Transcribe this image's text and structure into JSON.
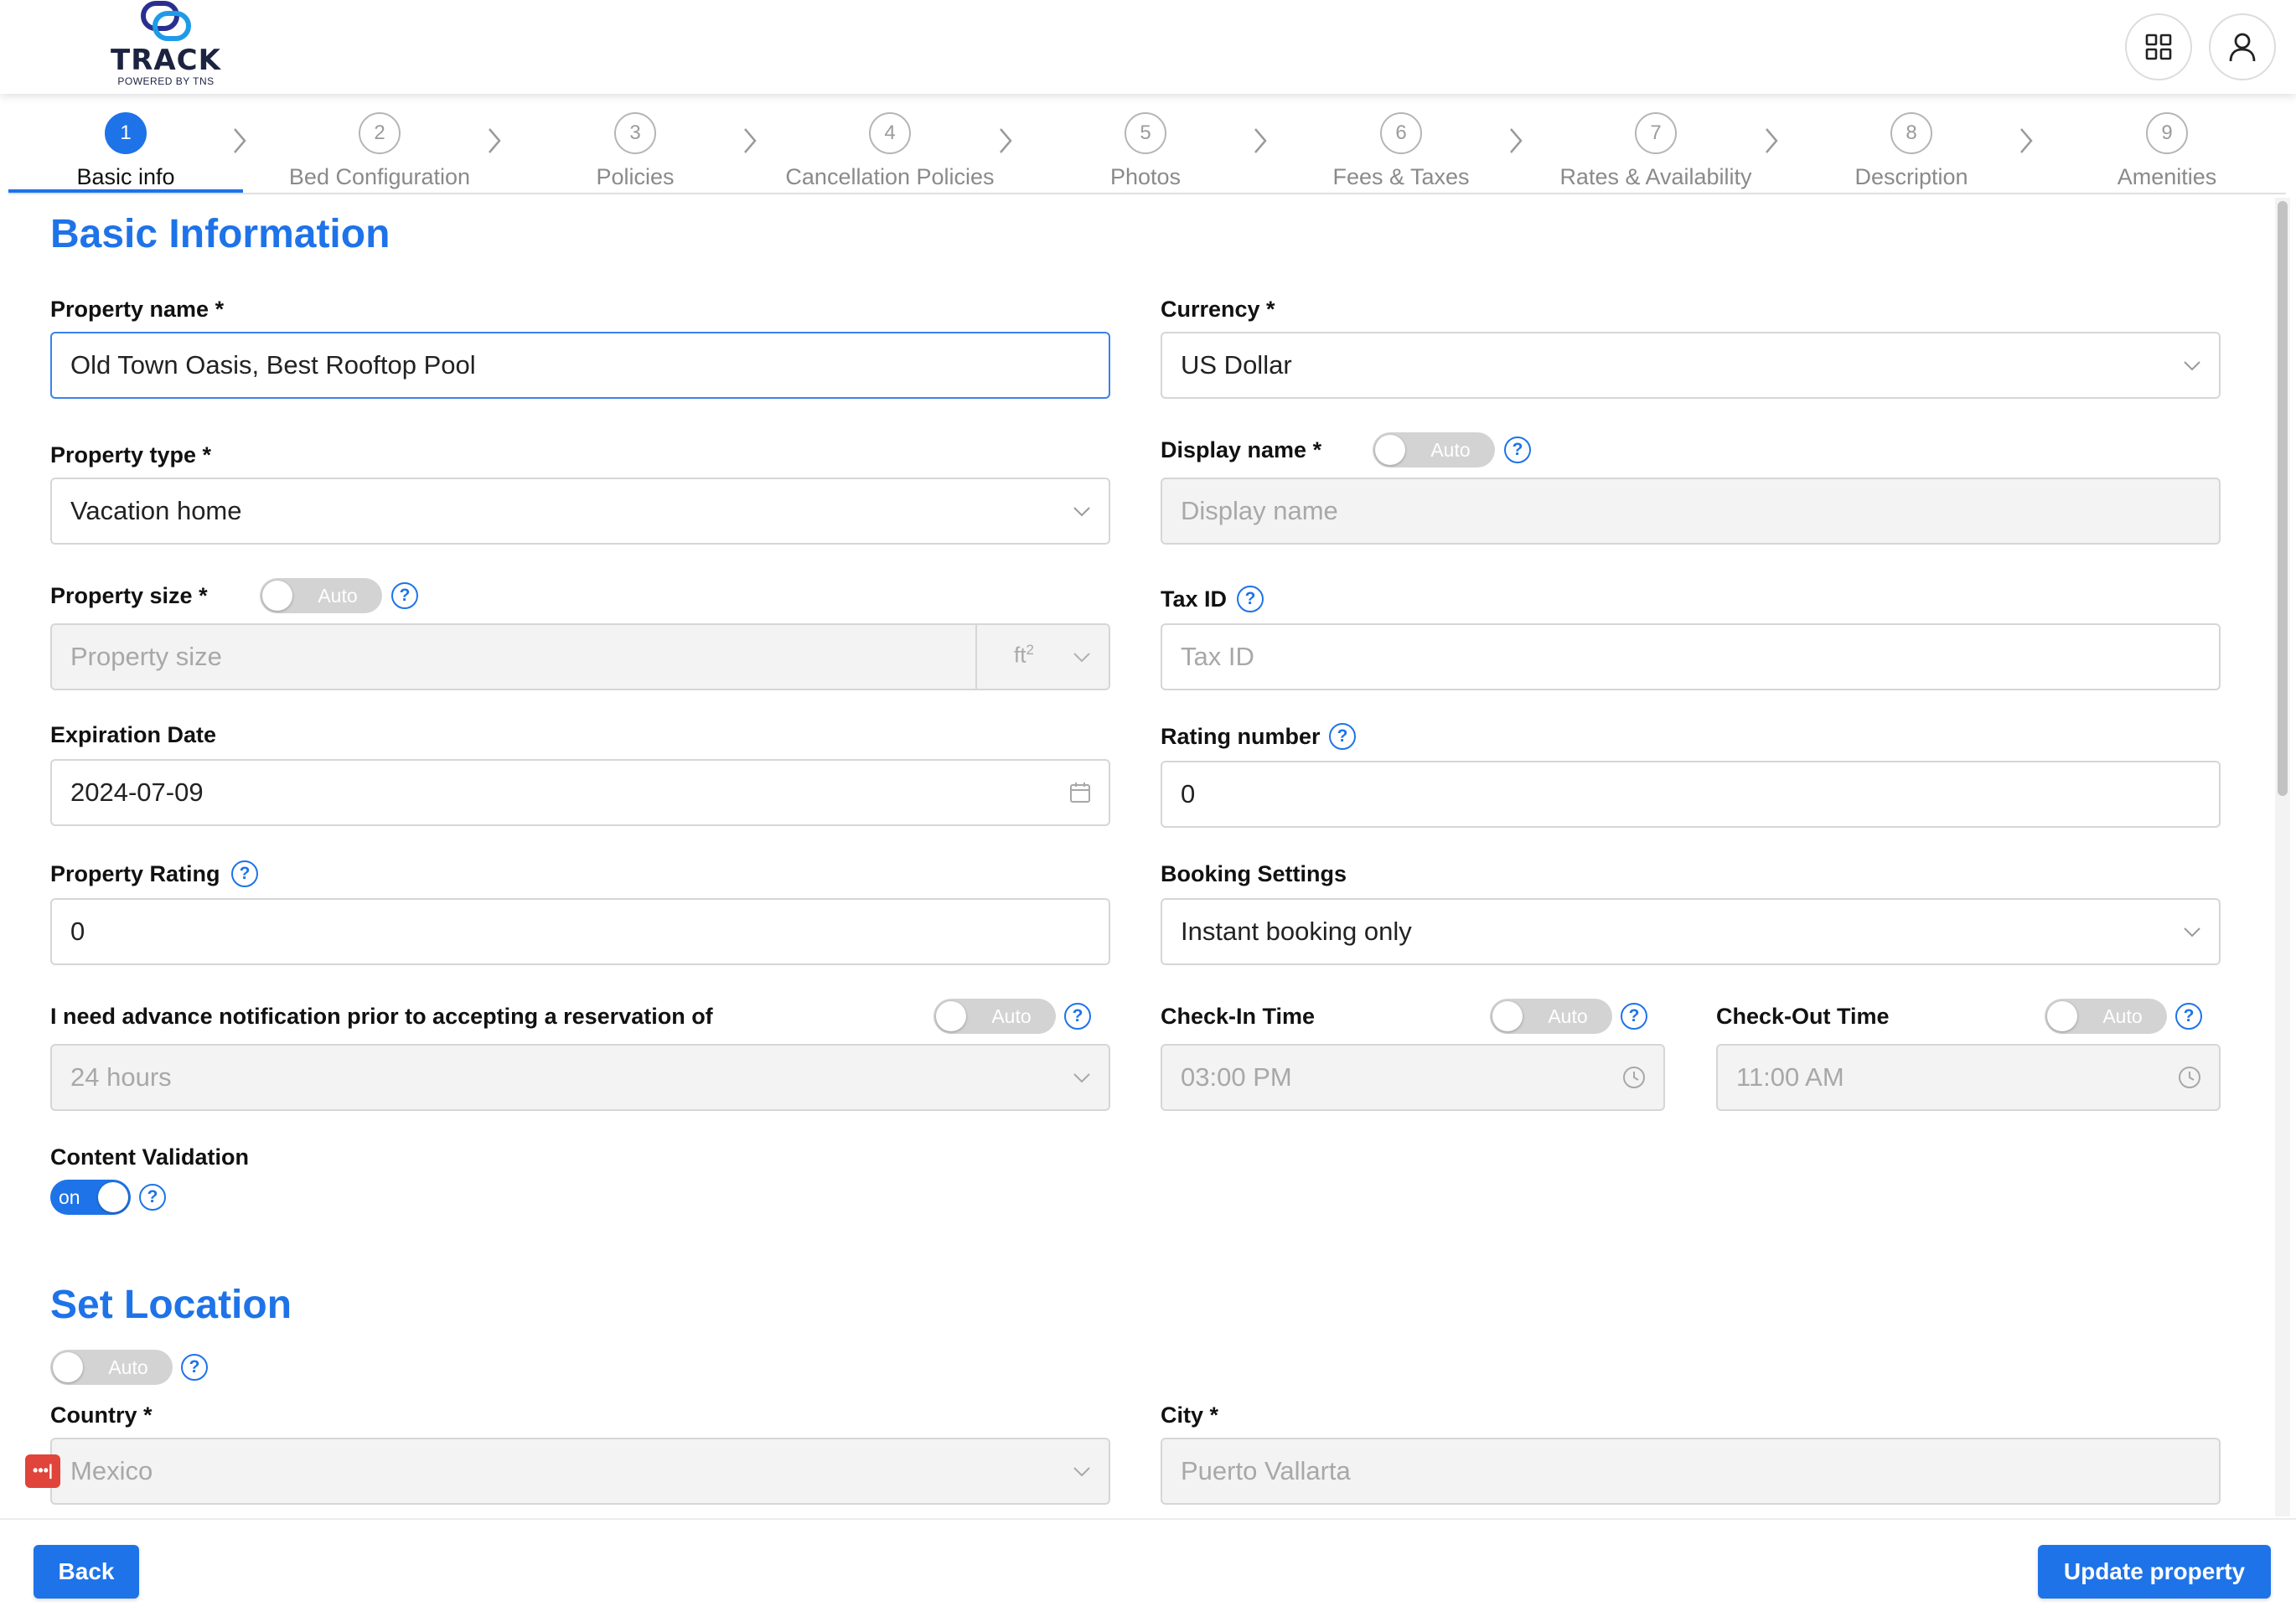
{
  "header": {
    "logo_text": "TRACK",
    "logo_sub": "POWERED BY TNS",
    "apps_icon": "grid-icon",
    "profile_icon": "user-icon"
  },
  "stepper": {
    "steps": [
      {
        "num": "1",
        "label": "Basic info"
      },
      {
        "num": "2",
        "label": "Bed Configuration"
      },
      {
        "num": "3",
        "label": "Policies"
      },
      {
        "num": "4",
        "label": "Cancellation Policies"
      },
      {
        "num": "5",
        "label": "Photos"
      },
      {
        "num": "6",
        "label": "Fees & Taxes"
      },
      {
        "num": "7",
        "label": "Rates & Availability"
      },
      {
        "num": "8",
        "label": "Description"
      },
      {
        "num": "9",
        "label": "Amenities"
      }
    ],
    "active_step": 1
  },
  "basic": {
    "title": "Basic Information",
    "property_name_label": "Property name *",
    "property_name_value": "Old Town Oasis, Best Rooftop Pool",
    "currency_label": "Currency *",
    "currency_value": "US Dollar",
    "property_type_label": "Property type *",
    "property_type_value": "Vacation home",
    "display_name_label": "Display name *",
    "display_name_toggle": "Auto",
    "display_name_placeholder": "Display name",
    "property_size_label": "Property size *",
    "property_size_toggle": "Auto",
    "property_size_placeholder": "Property size",
    "property_size_unit": "ft",
    "property_size_unit_exp": "2",
    "tax_id_label": "Tax ID",
    "tax_id_placeholder": "Tax ID",
    "expiration_label": "Expiration Date",
    "expiration_value": "2024-07-09",
    "rating_number_label": "Rating number",
    "rating_number_value": "0",
    "property_rating_label": "Property Rating",
    "property_rating_value": "0",
    "booking_settings_label": "Booking Settings",
    "booking_settings_value": "Instant booking only",
    "advance_label": "I need advance notification prior to accepting a reservation of",
    "advance_toggle": "Auto",
    "advance_value": "24 hours",
    "checkin_label": "Check-In Time",
    "checkin_toggle": "Auto",
    "checkin_value": "03:00 PM",
    "checkout_label": "Check-Out Time",
    "checkout_toggle": "Auto",
    "checkout_value": "11:00 AM",
    "content_validation_label": "Content Validation",
    "content_validation_toggle": "on",
    "help_glyph": "?"
  },
  "location": {
    "title": "Set Location",
    "toggle": "Auto",
    "country_label": "Country *",
    "country_value": "Mexico",
    "city_label": "City *",
    "city_value": "Puerto Vallarta"
  },
  "footer": {
    "back_label": "Back",
    "update_label": "Update property"
  },
  "colors": {
    "accent": "#1e73e8",
    "toggle_off": "#d3d3d3",
    "disabled_bg": "#f3f3f3",
    "badge": "#e0443a"
  }
}
